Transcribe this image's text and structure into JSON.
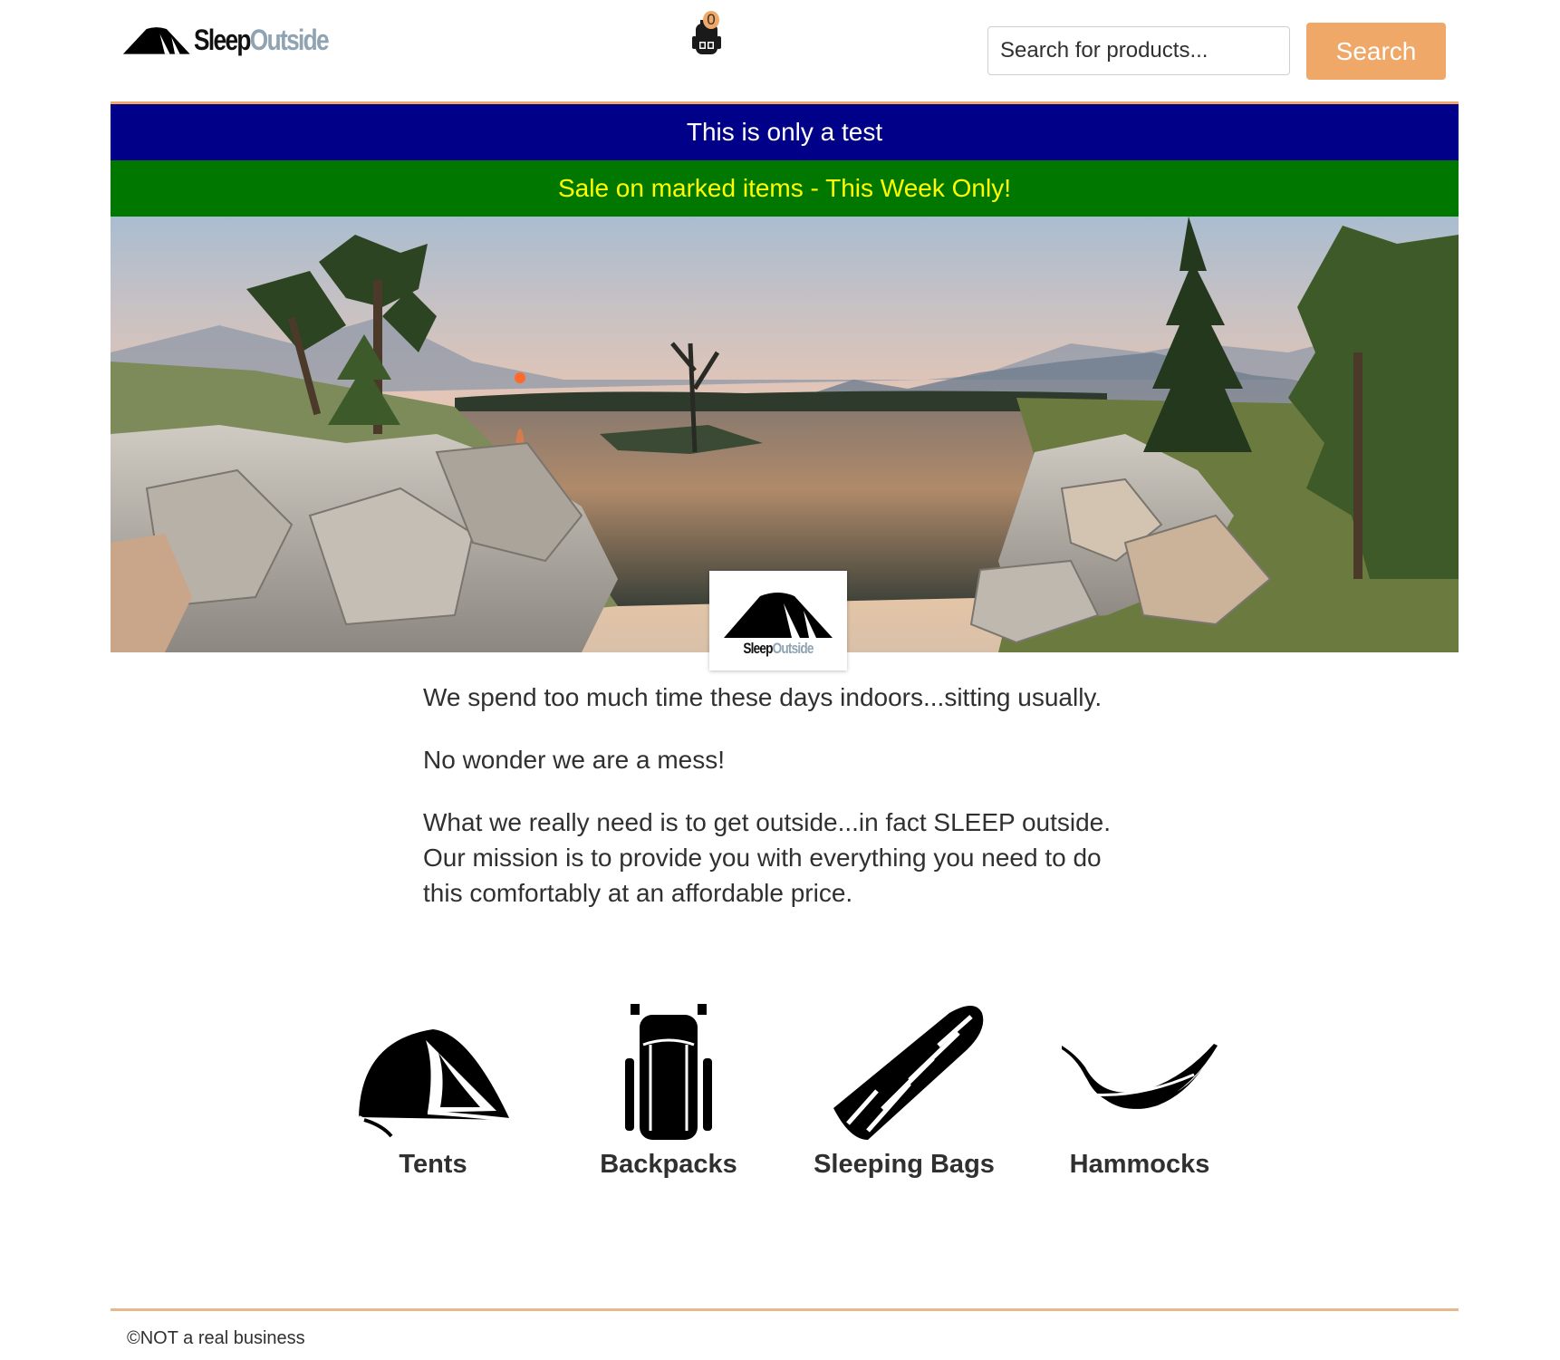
{
  "header": {
    "logo": {
      "sleep": "Sleep",
      "outside": "Outside"
    },
    "cart": {
      "count": "0",
      "icon": "backpack-cart-icon"
    },
    "search": {
      "placeholder": "Search for products...",
      "button_label": "Search"
    }
  },
  "alerts": [
    {
      "message": "This is only a test",
      "background": "#000088",
      "color": "#ffffff"
    },
    {
      "message": "Sale on marked items - This Week Only!",
      "background": "#007800",
      "color": "#ffff00"
    }
  ],
  "hero": {
    "logo": {
      "sleep": "Sleep",
      "outside": "Outside"
    }
  },
  "mission": {
    "paragraphs": [
      "We spend too much time these days indoors...sitting usually.",
      "No wonder we are a mess!",
      "What we really need is to get outside...in fact SLEEP outside. Our mission is to provide you with everything you need to do this comfortably at an affordable price."
    ]
  },
  "categories": [
    {
      "label": "Tents",
      "icon": "tent-icon"
    },
    {
      "label": "Backpacks",
      "icon": "backpack-icon"
    },
    {
      "label": "Sleeping Bags",
      "icon": "sleeping-bag-icon"
    },
    {
      "label": "Hammocks",
      "icon": "hammock-icon"
    }
  ],
  "footer": {
    "text": "©NOT a real business"
  },
  "colors": {
    "accent": "#f0a868",
    "logo_outside": "#8fa3b3",
    "text": "#303030"
  }
}
